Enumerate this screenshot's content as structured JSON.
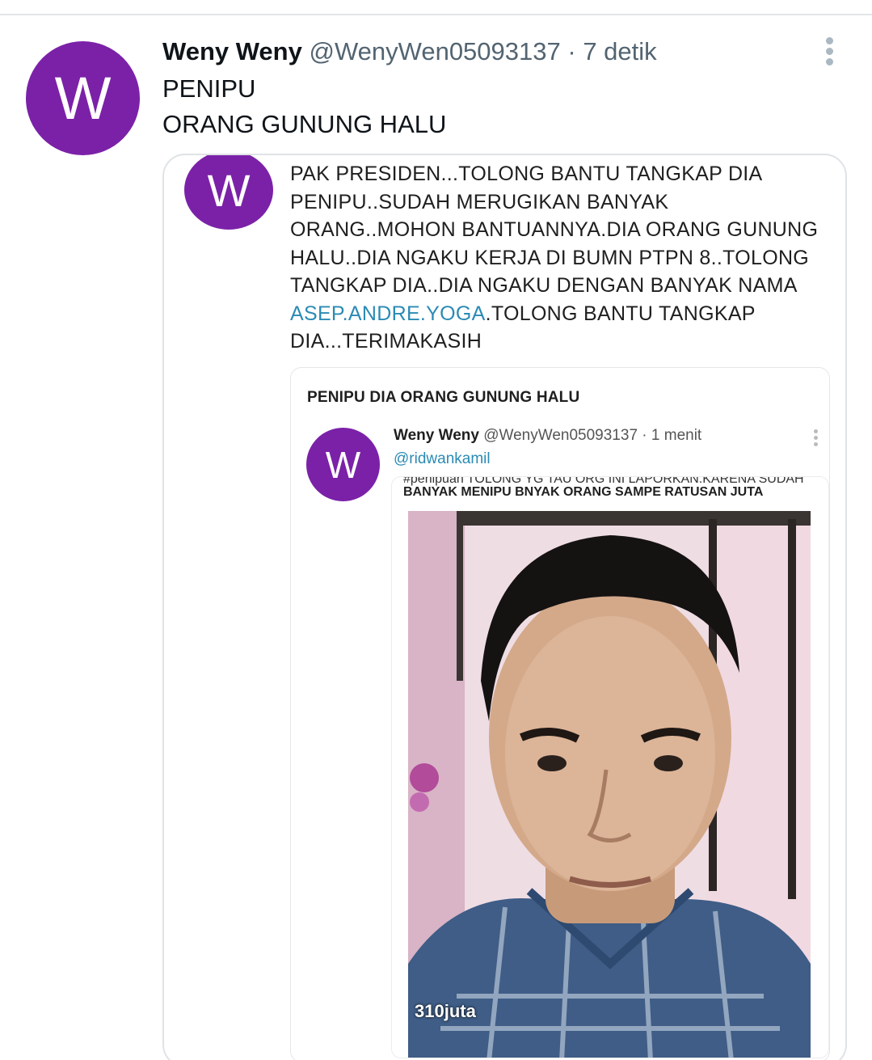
{
  "tweet": {
    "author_name": "Weny Weny",
    "handle": "@WenyWen05093137",
    "separator": "·",
    "time": "7 detik",
    "avatar_letter": "W",
    "lines": [
      "PENIPU",
      "ORANG GUNUNG HALU"
    ]
  },
  "media": {
    "avatar_letter": "W",
    "text_before_link": "PAK PRESIDEN...TOLONG BANTU TANGKAP DIA PENIPU..SUDAH MERUGIKAN BANYAK ORANG..MOHON BANTUANNYA.DIA ORANG GUNUNG HALU..DIA NGAKU KERJA DI BUMN PTPN 8..TOLONG TANGKAP DIA..DIA NGAKU DENGAN BANYAK NAMA ",
    "link_text": "ASEP.ANDRE.YOGA",
    "text_after_link": ".TOLONG BANTU TANGKAP DIA...TERIMAKASIH",
    "nested": {
      "title": "PENIPU DIA ORANG GUNUNG HALU",
      "avatar_letter": "W",
      "author_name": "Weny Weny",
      "handle": "@WenyWen05093137",
      "separator": "·",
      "time": "1 menit",
      "mention": "@ridwankamil",
      "cut_text": "#penipuan TOLONG YG TAU ORG INI LAPORKAN.KARENA SUDAH",
      "caption": "BANYAK MENIPU BNYAK ORANG SAMPE RATUSAN JUTA",
      "photo_label": "310juta"
    }
  },
  "colors": {
    "avatar": "#7b21a8",
    "link": "#2b8bb4",
    "secondary_text": "#536471"
  }
}
